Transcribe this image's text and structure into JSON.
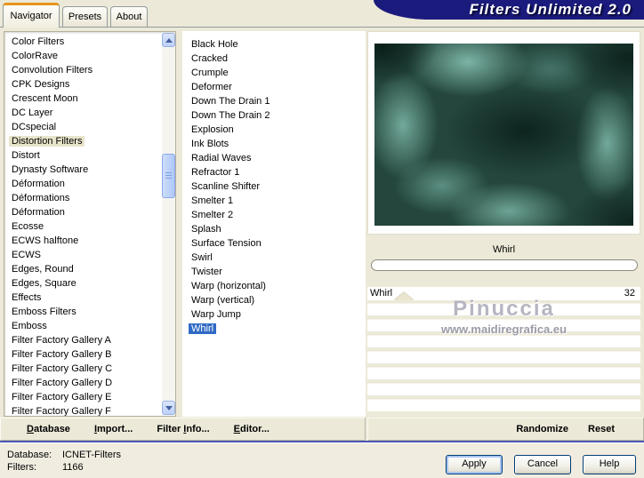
{
  "window": {
    "title": "Filters Unlimited 2.0"
  },
  "tabs": [
    {
      "label": "Navigator",
      "active": true
    },
    {
      "label": "Presets",
      "active": false
    },
    {
      "label": "About",
      "active": false
    }
  ],
  "category_list": {
    "items": [
      "Color Filters",
      "ColorRave",
      "Convolution Filters",
      "CPK Designs",
      "Crescent Moon",
      "DC Layer",
      "DCspecial",
      "Distortion Filters",
      "Distort",
      "Dynasty Software",
      "Déformation",
      "Déformations",
      "Déformation",
      "Ecosse",
      "ECWS halftone",
      "ECWS",
      "Edges, Round",
      "Edges, Square",
      "Effects",
      "Emboss Filters",
      "Emboss",
      "Filter Factory Gallery A",
      "Filter Factory Gallery B",
      "Filter Factory Gallery C",
      "Filter Factory Gallery D",
      "Filter Factory Gallery E",
      "Filter Factory Gallery F"
    ],
    "selected": "Distortion Filters"
  },
  "filter_list": {
    "items": [
      "Black Hole",
      "Cracked",
      "Crumple",
      "Deformer",
      "Down The Drain 1",
      "Down The Drain 2",
      "Explosion",
      "Ink Blots",
      "Radial Waves",
      "Refractor 1",
      "Scanline Shifter",
      "Smelter 1",
      "Smelter 2",
      "Splash",
      "Surface Tension",
      "Swirl",
      "Twister",
      "Warp (horizontal)",
      "Warp (vertical)",
      "Warp Jump",
      "Whirl"
    ],
    "selected": "Whirl"
  },
  "preview": {
    "filter_name": "Whirl"
  },
  "parameters": {
    "rows": [
      {
        "name": "Whirl",
        "value": "32"
      }
    ],
    "empty_row_count": 7
  },
  "watermark": {
    "line1": "Pinuccia",
    "line2": "www.maidiregrafica.eu"
  },
  "toolbar": {
    "database": {
      "pre": "",
      "accel": "D",
      "post": "atabase"
    },
    "import": {
      "pre": "",
      "accel": "I",
      "post": "mport..."
    },
    "filter_info": {
      "pre": "Filter ",
      "accel": "I",
      "post": "nfo..."
    },
    "editor": {
      "pre": "",
      "accel": "E",
      "post": "ditor..."
    },
    "randomize": "Randomize",
    "reset": "Reset"
  },
  "status": {
    "database_label": "Database:",
    "database_value": "ICNET-Filters",
    "filters_label": "Filters:",
    "filters_value": "1166"
  },
  "buttons": {
    "apply": "Apply",
    "cancel": "Cancel",
    "help": "Help"
  },
  "icons": {
    "scroll_up": "chevron-up",
    "scroll_down": "chevron-down",
    "slider_thumb": "triangle-up"
  },
  "colors": {
    "selection_blue": "#316ac5",
    "category_highlight": "#e8e4cb",
    "title_navy": "#1b1b7e",
    "active_tab_accent": "#e5941e",
    "preview_light": "#7ab4a4",
    "preview_dark": "#0f2a23"
  }
}
